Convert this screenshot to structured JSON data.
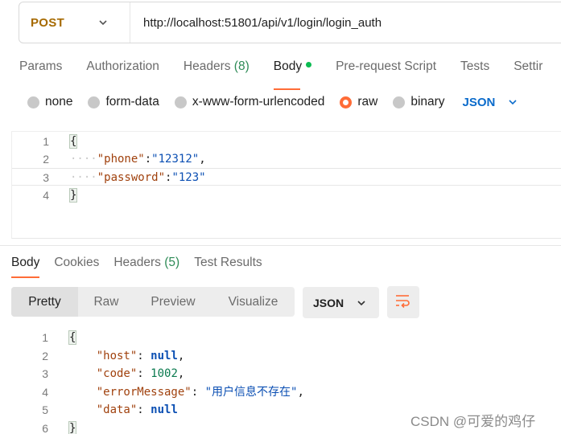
{
  "request": {
    "method": "POST",
    "url": "http://localhost:51801/api/v1/login/login_auth"
  },
  "request_tabs": [
    {
      "label": "Params"
    },
    {
      "label": "Authorization"
    },
    {
      "label": "Headers",
      "count": "(8)"
    },
    {
      "label": "Body"
    },
    {
      "label": "Pre-request Script"
    },
    {
      "label": "Tests"
    },
    {
      "label": "Settir"
    }
  ],
  "body_types": [
    "none",
    "form-data",
    "x-www-form-urlencoded",
    "raw",
    "binary"
  ],
  "body_format": "JSON",
  "request_body": {
    "line_numbers": [
      "1",
      "2",
      "3",
      "4"
    ],
    "open_brace": "{",
    "close_brace": "}",
    "phone_key": "\"phone\"",
    "phone_value": "\"12312\"",
    "password_key": "\"password\"",
    "password_value": "\"123\""
  },
  "response_tabs": [
    {
      "label": "Body"
    },
    {
      "label": "Cookies"
    },
    {
      "label": "Headers",
      "count": "(5)"
    },
    {
      "label": "Test Results"
    }
  ],
  "response_views": [
    "Pretty",
    "Raw",
    "Preview",
    "Visualize"
  ],
  "response_format": "JSON",
  "response_body": {
    "line_numbers": [
      "1",
      "2",
      "3",
      "4",
      "5",
      "6"
    ],
    "open_brace": "{",
    "close_brace": "}",
    "host_key": "\"host\"",
    "host_value": "null",
    "code_key": "\"code\"",
    "code_value": "1002",
    "error_key": "\"errorMessage\"",
    "error_value": "\"用户信息不存在\"",
    "data_key": "\"data\"",
    "data_value": "null"
  },
  "watermark": "CSDN @可爱的鸡仔",
  "colors": {
    "accent": "#ff6c37",
    "method": "#a66a00",
    "link_blue": "#0b6bcb",
    "count_green": "#2e8b57"
  }
}
